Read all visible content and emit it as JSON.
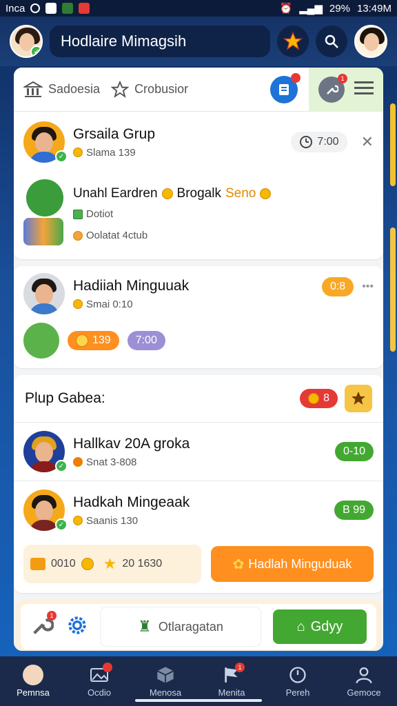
{
  "status": {
    "carrier": "Inca",
    "battery": "29%",
    "time": "13:49M"
  },
  "header": {
    "title": "Hodlaire Mimagsih"
  },
  "tabs": {
    "tab1": "Sadoesia",
    "tab2": "Crobusior"
  },
  "list": {
    "item1": {
      "title": "Grsaila Grup",
      "sub": "Slama 139",
      "time": "7:00"
    },
    "item2": {
      "title_a": "Unahl Eardren",
      "title_b": "Brogalk",
      "title_c": "Seno",
      "sub1": "Dotiot",
      "sub2": "Oolatat 4ctub"
    },
    "item3": {
      "title": "Hadiiah Minguuak",
      "sub": "Smai 0:10",
      "tag": "0:8",
      "coin_count": "139",
      "timer": "7:00"
    }
  },
  "section": {
    "title": "Plup Gabea:",
    "badge": "8",
    "rows": [
      {
        "title": "Hallkav 20A groka",
        "sub": "Snat 3-808",
        "tag": "0-10"
      },
      {
        "title": "Hadkah Mingeaak",
        "sub": "Saanis 130",
        "tag": "B 99"
      }
    ],
    "rewards": {
      "coins": "0010",
      "stars": "20 1630"
    },
    "cta": "Hadlah Minguduak"
  },
  "actions": {
    "middle": "Otlaragatan",
    "primary": "Gdyy"
  },
  "nav": {
    "items": [
      "Pemnsa",
      "Ocdio",
      "Menosa",
      "Menita",
      "Pereh",
      "Gemoce"
    ]
  },
  "colors": {
    "orange": "#ff8f1f",
    "green": "#43a832",
    "blue": "#1e73d8"
  }
}
